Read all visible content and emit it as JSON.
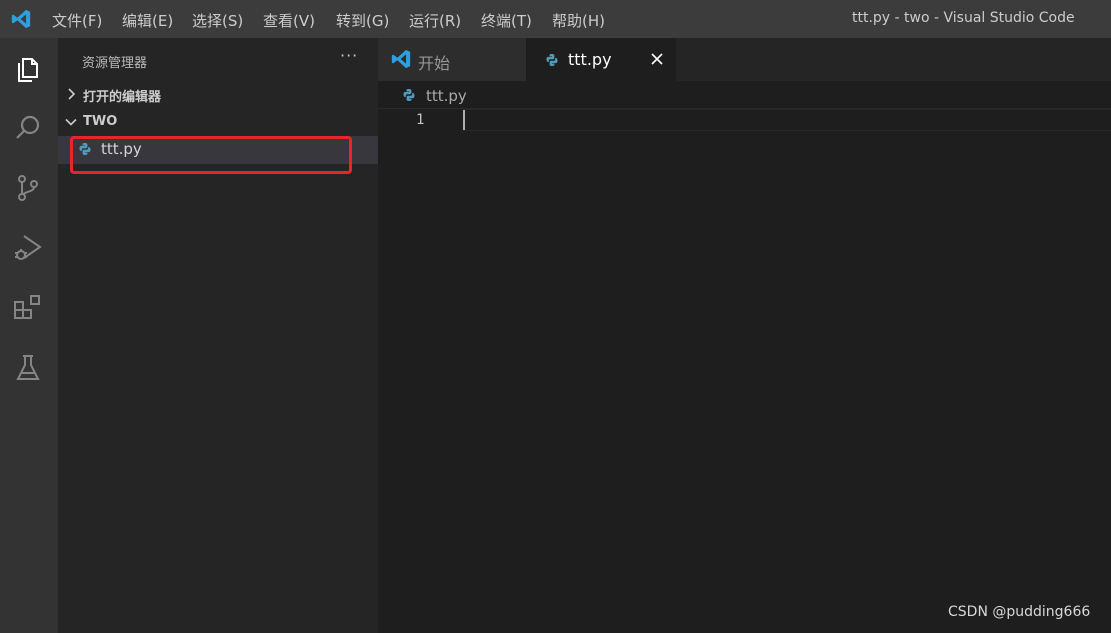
{
  "titlebar": {
    "menu": [
      "文件(F)",
      "编辑(E)",
      "选择(S)",
      "查看(V)",
      "转到(G)",
      "运行(R)",
      "终端(T)",
      "帮助(H)"
    ],
    "title": "ttt.py - two - Visual Studio Code"
  },
  "activitybar": {
    "icons": [
      "explorer-icon",
      "search-icon",
      "source-control-icon",
      "run-debug-icon",
      "extensions-icon",
      "testing-icon"
    ]
  },
  "sidebar": {
    "header": "资源管理器",
    "more": "···",
    "open_editors": "打开的编辑器",
    "folder": "TWO",
    "file": "ttt.py"
  },
  "tabs": [
    {
      "label": "开始"
    },
    {
      "label": "ttt.py"
    }
  ],
  "breadcrumb": "ttt.py",
  "editor": {
    "line_numbers": [
      "1"
    ]
  },
  "watermark": "CSDN @pudding666",
  "colors": {
    "accent": "#007acc",
    "python_blue": "#519aba",
    "highlight_red": "#e8262a"
  }
}
